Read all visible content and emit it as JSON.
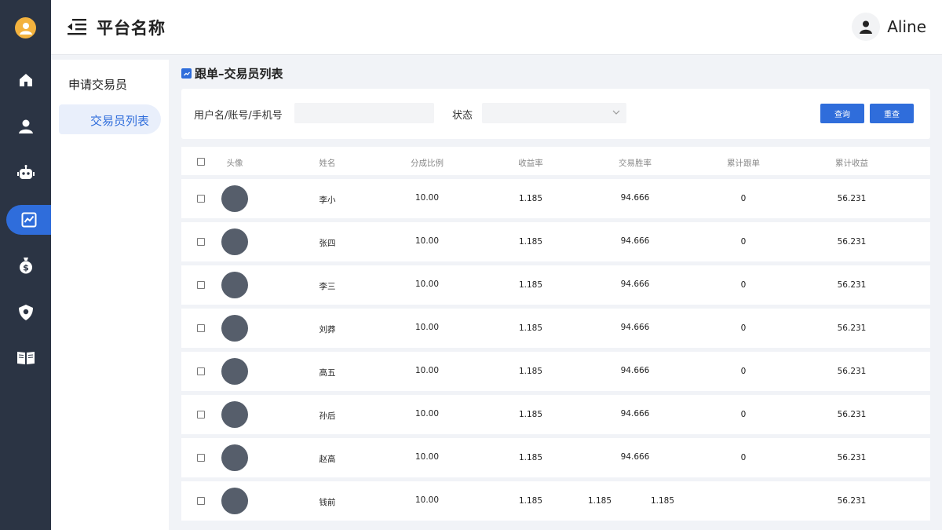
{
  "app": {
    "title": "平台名称",
    "user_name": "Aline"
  },
  "rail": {
    "icons": [
      "logo-icon",
      "home-icon",
      "user-icon",
      "robot-icon",
      "chart-icon",
      "money-bag-icon",
      "shield-icon",
      "book-icon"
    ],
    "active": "chart-icon"
  },
  "submenu": {
    "items": [
      {
        "label": "申请交易员"
      },
      {
        "label": "交易员列表"
      }
    ]
  },
  "page": {
    "breadcrumb": "跟单–交易员列表"
  },
  "filter": {
    "username_label": "用户名/账号/手机号",
    "username_value": "",
    "status_label": "状态",
    "status_value": "",
    "search_label": "查询",
    "reset_label": "重查"
  },
  "table": {
    "headers": [
      "头像",
      "姓名",
      "分成比例",
      "收益率",
      "交易胜率",
      "累计跟单",
      "累计收益"
    ],
    "rows": [
      {
        "name": "李小",
        "ratio": "10.00",
        "yield": "1.185",
        "win_rate": "94.666",
        "follows": "0",
        "profit": "56.231"
      },
      {
        "name": "张四",
        "ratio": "10.00",
        "yield": "1.185",
        "win_rate": "94.666",
        "follows": "0",
        "profit": "56.231"
      },
      {
        "name": "李三",
        "ratio": "10.00",
        "yield": "1.185",
        "win_rate": "94.666",
        "follows": "0",
        "profit": "56.231"
      },
      {
        "name": "刘莽",
        "ratio": "10.00",
        "yield": "1.185",
        "win_rate": "94.666",
        "follows": "0",
        "profit": "56.231"
      },
      {
        "name": "高五",
        "ratio": "10.00",
        "yield": "1.185",
        "win_rate": "94.666",
        "follows": "0",
        "profit": "56.231"
      },
      {
        "name": "孙后",
        "ratio": "10.00",
        "yield": "1.185",
        "win_rate": "94.666",
        "follows": "0",
        "profit": "56.231"
      },
      {
        "name": "赵高",
        "ratio": "10.00",
        "yield": "1.185",
        "win_rate": "94.666",
        "follows": "0",
        "profit": "56.231"
      },
      {
        "name": "钱前",
        "ratio": "10.00",
        "yield": "1.185",
        "win_rate": "1.185",
        "follows": "1.185",
        "profit": "56.231"
      }
    ]
  },
  "colors": {
    "rail_bg": "#2b3444",
    "accent": "#2f6ddb",
    "logo": "#f3b23e",
    "avatar": "#565e6b"
  }
}
